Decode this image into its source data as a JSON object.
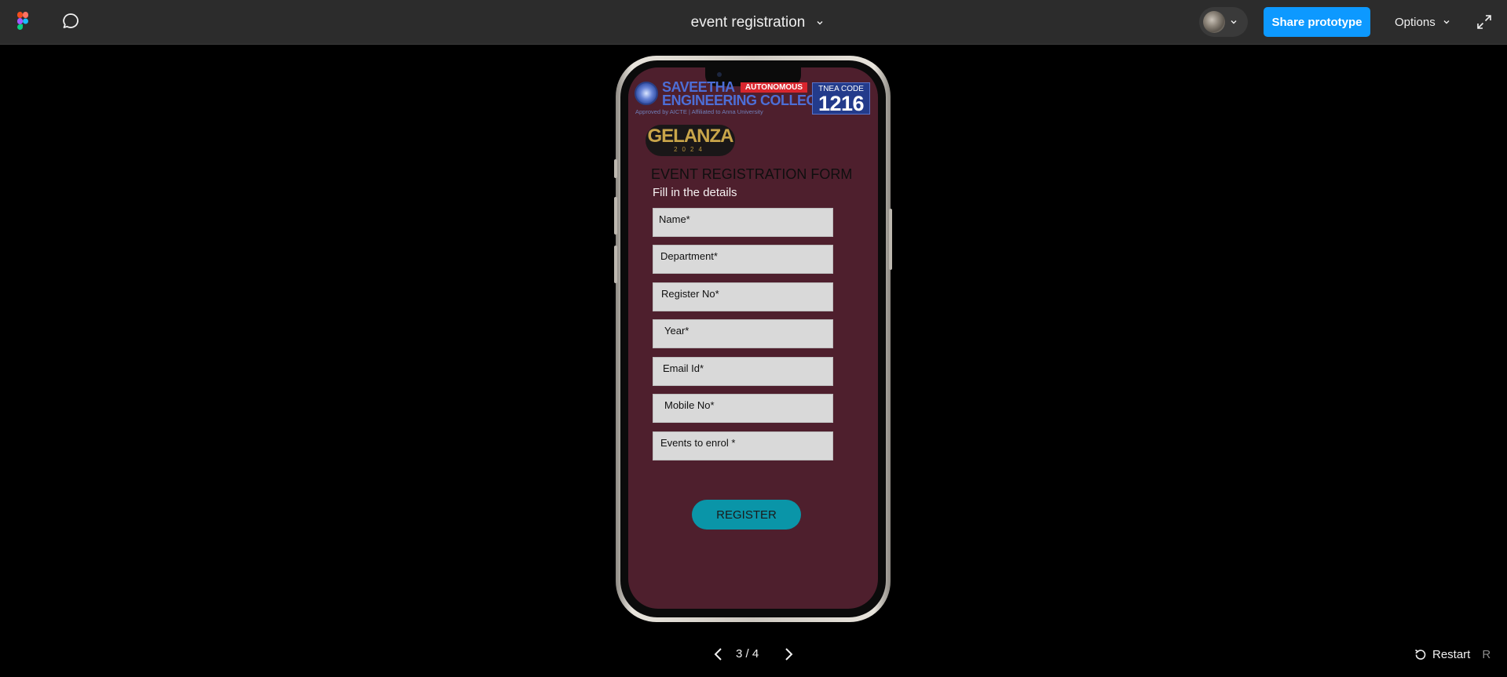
{
  "topbar": {
    "doc_title": "event registration",
    "share_label": "Share prototype",
    "options_label": "Options"
  },
  "screen": {
    "college_name_line1": "SAVEETHA",
    "college_name_line2": "ENGINEERING COLLEGE",
    "autonomous_label": "AUTONOMOUS",
    "approval_text": "Approved by AICTE | Affiliated to Anna University",
    "tnea_label": "TNEA CODE",
    "tnea_code": "1216",
    "event_logo": "GELANZA",
    "event_year": "2024",
    "form_title": "EVENT REGISTRATION FORM",
    "form_subtitle": "Fill in the details",
    "fields": [
      {
        "label": "Name*"
      },
      {
        "label": "Department*"
      },
      {
        "label": "Register No*"
      },
      {
        "label": "Year*"
      },
      {
        "label": "Email Id*"
      },
      {
        "label": "Mobile No*"
      },
      {
        "label": "Events to enrol *"
      }
    ],
    "register_label": "REGISTER"
  },
  "footer": {
    "page_indicator": "3 / 4",
    "restart_label": "Restart",
    "restart_key": "R"
  },
  "colors": {
    "topbar_bg": "#2c2c2c",
    "share_button": "#0d99ff",
    "screen_bg": "#4e1f2d",
    "field_bg": "#d9d9d9",
    "register_button": "#0a95a8"
  },
  "icons": [
    "figma-logo-icon",
    "comment-icon",
    "chevron-down-icon",
    "expand-icon",
    "chevron-left-icon",
    "chevron-right-icon",
    "restart-icon"
  ]
}
